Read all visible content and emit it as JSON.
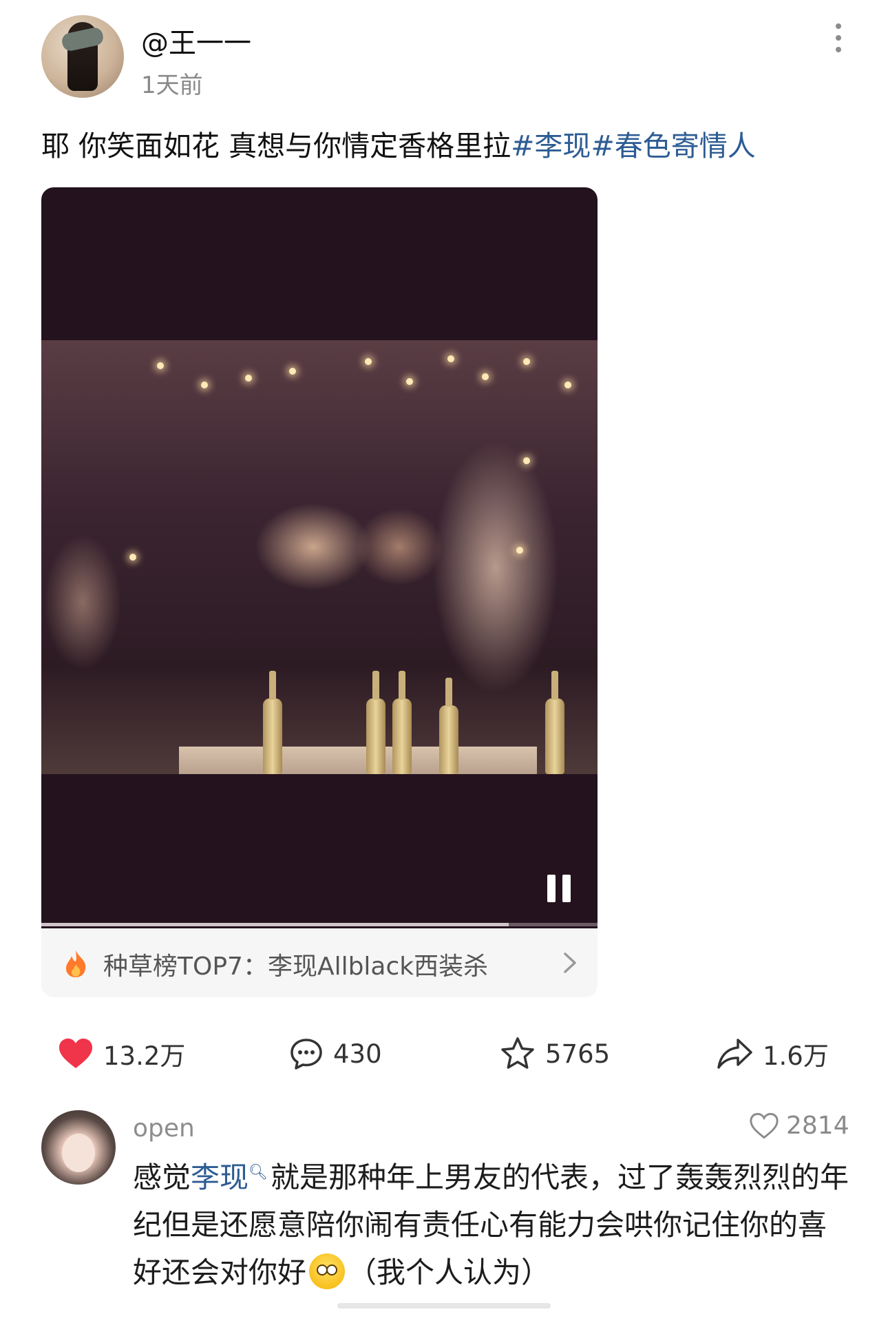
{
  "post": {
    "author": "@王一一",
    "time": "1天前",
    "text_plain": "耶 你笑面如花 真想与你情定香格里拉",
    "hashtags": [
      "#李现",
      "#春色寄情人"
    ]
  },
  "video": {
    "progress_fraction": 0.84,
    "state": "playing"
  },
  "topic": {
    "label": "种草榜TOP7：李现Allblack西装杀"
  },
  "actions": {
    "likes": "13.2万",
    "comments": "430",
    "favorites": "5765",
    "shares": "1.6万"
  },
  "comment": {
    "user": "open",
    "likes": "2814",
    "prefix": "感觉",
    "mention": "李现",
    "suffix": "就是那种年上男友的代表，过了轰轰烈烈的年纪但是还愿意陪你闹有责任心有能力会哄你记住你的喜好还会对你好",
    "tail": "（我个人认为）"
  },
  "colors": {
    "link": "#2d5c93",
    "like_red": "#f0344a",
    "muted": "#8a8a8a"
  },
  "icons": [
    "more-vertical-icon",
    "pause-icon",
    "flame-icon",
    "chevron-right-icon",
    "heart-filled-icon",
    "comment-bubble-icon",
    "star-icon",
    "share-icon",
    "heart-outline-icon",
    "search-icon",
    "thinking-emoji-icon"
  ]
}
